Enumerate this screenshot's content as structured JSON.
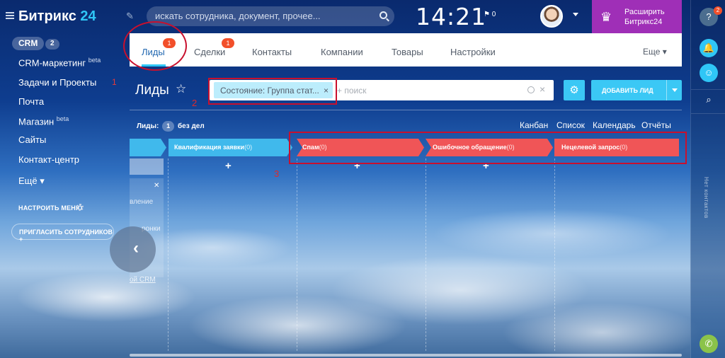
{
  "header": {
    "logo_text": "Битрикс",
    "logo_num": "24",
    "search_placeholder": "искать сотрудника, документ, прочее...",
    "clock": "14:21",
    "flag_count": "0",
    "upgrade_line1": "Расширить",
    "upgrade_line2": "Битрикс24"
  },
  "sidebar": {
    "crm_label": "CRM",
    "crm_count": "2",
    "items": [
      {
        "label": "CRM-маркетинг",
        "sup": "beta"
      },
      {
        "label": "Задачи и Проекты",
        "sup": ""
      },
      {
        "label": "Почта",
        "sup": ""
      },
      {
        "label": "Магазин",
        "sup": "beta"
      },
      {
        "label": "Сайты",
        "sup": ""
      },
      {
        "label": "Контакт-центр",
        "sup": ""
      },
      {
        "label": "Ещё ▾",
        "sup": ""
      }
    ],
    "setup_label": "НАСТРОИТЬ МЕНЮ",
    "invite_label": "ПРИГЛАСИТЬ СОТРУДНИКОВ  +"
  },
  "tabs": [
    {
      "label": "Лиды",
      "badge": "1"
    },
    {
      "label": "Сделки",
      "badge": "1"
    },
    {
      "label": "Контакты",
      "badge": ""
    },
    {
      "label": "Компании",
      "badge": ""
    },
    {
      "label": "Товары",
      "badge": ""
    },
    {
      "label": "Настройки",
      "badge": ""
    }
  ],
  "more_label": "Еще ▾",
  "page": {
    "title": "Лиды",
    "filter_chip": "Состояние: Группа стат...",
    "filter_placeholder": "+ поиск",
    "add_button": "ДОБАВИТЬ ЛИД",
    "leads_label": "Лиды:",
    "leads_count": "1",
    "leads_suffix": "без дел",
    "views": [
      "Канбан",
      "Список",
      "Календарь",
      "Отчёты"
    ]
  },
  "stages": [
    {
      "name": "Квалификация заявки",
      "count": "(0)",
      "color": "#40b9ec"
    },
    {
      "name": "Спам",
      "count": "(0)",
      "color": "#f05557"
    },
    {
      "name": "Ошибочное обращение",
      "count": "(0)",
      "color": "#f05557"
    },
    {
      "name": "Нецелевой запрос",
      "count": "(0)",
      "color": "#f05557"
    }
  ],
  "left_card": {
    "lines": [
      "вление",
      "ронки",
      "ой CRM"
    ]
  },
  "annotations": {
    "n1": "1",
    "n2": "2",
    "n3": "3"
  },
  "rightbar": {
    "help_badge": "2",
    "vertical_text": "Нет контактов"
  },
  "colors": {
    "accent": "#2fc6f6",
    "upgrade": "#9f2fb7",
    "stage_red": "#f05557",
    "stage_blue": "#40b9ec",
    "annotation": "#c8102e"
  }
}
